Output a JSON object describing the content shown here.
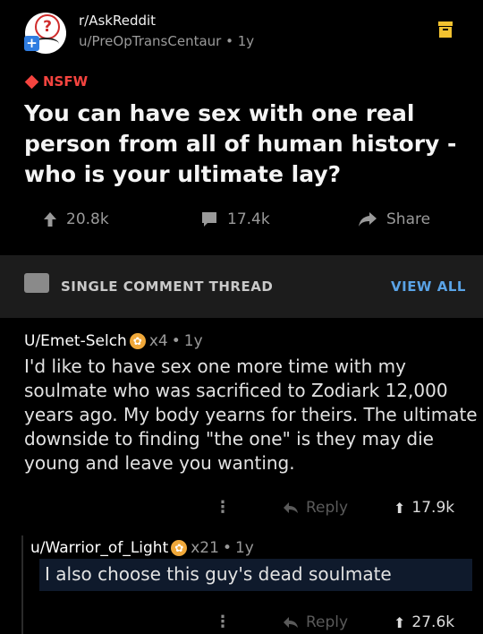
{
  "post": {
    "subreddit": "r/AskReddit",
    "author": "u/PreOpTransCentaur",
    "age": "1y",
    "nsfw_label": "NSFW",
    "title": "You can have sex with one real person from all of human history - who is your ultimate lay?",
    "upvotes": "20.8k",
    "comments": "17.4k",
    "share_label": "Share"
  },
  "thread": {
    "label": "SINGLE COMMENT THREAD",
    "view_all": "VIEW ALL"
  },
  "comments": [
    {
      "user": "U/Emet-Selch",
      "award_count": "x4",
      "age": "1y",
      "body": "I'd like to have sex one more time with my soulmate who was sacrificed to Zodiark 12,000 years ago. My body yearns for theirs. The ultimate downside to finding \"the one\" is they may die young and leave you wanting.",
      "reply_label": "Reply",
      "score": "17.9k"
    },
    {
      "user": "u/Warrior_of_Light",
      "award_count": "x21",
      "age": "1y",
      "body": "I also choose this guy's dead soulmate",
      "reply_label": "Reply",
      "score": "27.6k"
    }
  ],
  "colors": {
    "background": "#000000",
    "nsfw": "#f5443f",
    "link": "#5aa3e6",
    "thread_bar": "#1c1c1c",
    "award": "#f0a83a"
  },
  "icons": [
    "subreddit-avatar-icon",
    "join-plus-icon",
    "save-icon",
    "nsfw-diamond-icon",
    "upvote-icon",
    "comment-icon",
    "share-arrow-icon",
    "thread-icon",
    "award-icon",
    "more-icon",
    "reply-icon"
  ]
}
